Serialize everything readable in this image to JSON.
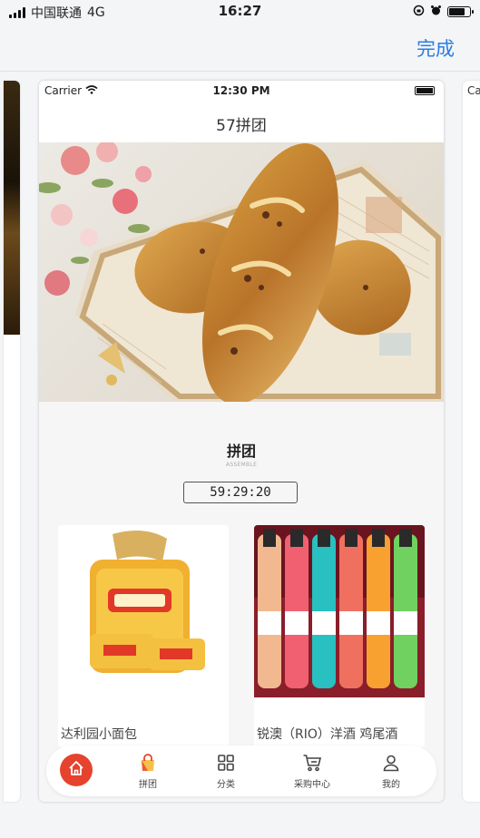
{
  "status_bar": {
    "carrier": "中国联通",
    "network": "4G",
    "time": "16:27",
    "battery_level": 0.85
  },
  "header": {
    "done_label": "完成"
  },
  "side_right": {
    "peek_text": "Ca"
  },
  "phone": {
    "status": {
      "carrier": "Carrier",
      "time": "12:30 PM"
    },
    "nav_title": "57拼团",
    "section": {
      "title": "拼团",
      "subtitle": "ASSEMBLE",
      "countdown": "59:29:20"
    },
    "products": [
      {
        "name": "达利园小面包"
      },
      {
        "name": "锐澳（RIO）洋酒 鸡尾酒"
      }
    ],
    "tabbar": {
      "items": [
        {
          "label": "拼团",
          "icon": "group-buy-bag-icon"
        },
        {
          "label": "分类",
          "icon": "category-grid-icon"
        },
        {
          "label": "采购中心",
          "icon": "cart-icon"
        },
        {
          "label": "我的",
          "icon": "user-icon"
        }
      ],
      "active_color": "#e5432e"
    }
  },
  "colors": {
    "accent_blue": "#2a7de1",
    "home_red": "#e5432e"
  }
}
